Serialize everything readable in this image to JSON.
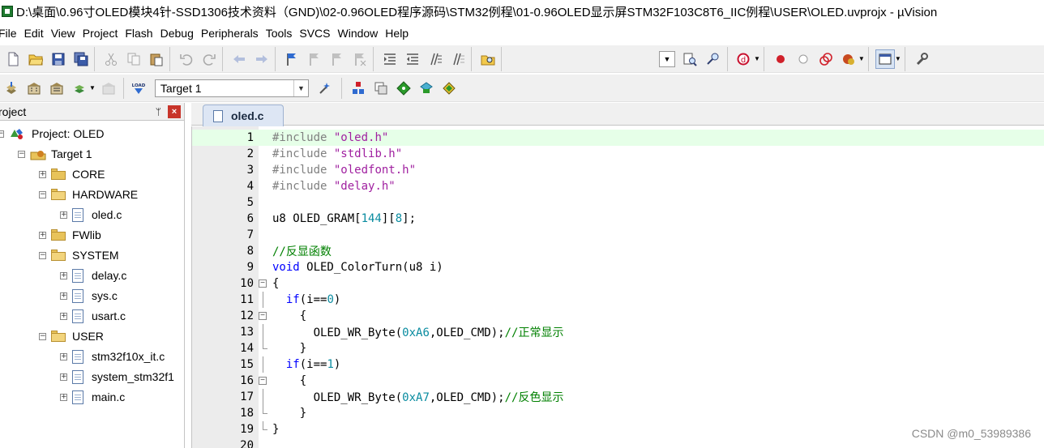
{
  "window": {
    "title": "D:\\桌面\\0.96寸OLED模块4针-SSD1306技术资料（GND)\\02-0.96OLED程序源码\\STM32例程\\01-0.96OLED显示屏STM32F103C8T6_IIC例程\\USER\\OLED.uvprojx - µVision"
  },
  "menu": [
    "File",
    "Edit",
    "View",
    "Project",
    "Flash",
    "Debug",
    "Peripherals",
    "Tools",
    "SVCS",
    "Window",
    "Help"
  ],
  "toolbar2": {
    "target_value": "Target 1",
    "load_label": "LOAD"
  },
  "project_pane": {
    "title": "roject",
    "pin_glyph": "ᛘ",
    "close_glyph": "×",
    "tree": {
      "project": "Project: OLED",
      "target": "Target 1",
      "core": "CORE",
      "hardware": "HARDWARE",
      "oled_c": "oled.c",
      "fwlib": "FWlib",
      "system": "SYSTEM",
      "delay_c": "delay.c",
      "sys_c": "sys.c",
      "usart_c": "usart.c",
      "user": "USER",
      "stm32_it": "stm32f10x_it.c",
      "system_stm32": "system_stm32f1",
      "main_c": "main.c"
    }
  },
  "editor": {
    "tab_label": "oled.c",
    "lines": [
      {
        "n": "1",
        "include": "#include",
        "file": "\"oled.h\""
      },
      {
        "n": "2",
        "include": "#include",
        "file": "\"stdlib.h\""
      },
      {
        "n": "3",
        "include": "#include",
        "file": "\"oledfont.h\""
      },
      {
        "n": "4",
        "include": "#include",
        "file": "\"delay.h\""
      },
      {
        "n": "5"
      },
      {
        "n": "6",
        "decl_a": "u8 OLED_GRAM[",
        "num1": "144",
        "decl_b": "][",
        "num2": "8",
        "decl_c": "];"
      },
      {
        "n": "7"
      },
      {
        "n": "8",
        "comment": "//反显函数"
      },
      {
        "n": "9",
        "kw": "void",
        "rest": " OLED_ColorTurn(u8 i)"
      },
      {
        "n": "10",
        "text": "{"
      },
      {
        "n": "11",
        "kw": "if",
        "rest_a": "(i==",
        "num": "0",
        "rest_b": ")"
      },
      {
        "n": "12",
        "text": "{"
      },
      {
        "n": "13",
        "call": "OLED_WR_Byte(",
        "num": "0xA6",
        "call_b": ",OLED_CMD);",
        "comment": "//正常显示"
      },
      {
        "n": "14",
        "text": "}"
      },
      {
        "n": "15",
        "kw": "if",
        "rest_a": "(i==",
        "num": "1",
        "rest_b": ")"
      },
      {
        "n": "16",
        "text": "{"
      },
      {
        "n": "17",
        "call": "OLED_WR_Byte(",
        "num": "0xA7",
        "call_b": ",OLED_CMD);",
        "comment": "//反色显示"
      },
      {
        "n": "18",
        "text": "}"
      },
      {
        "n": "19",
        "text": "}"
      },
      {
        "n": "20"
      }
    ]
  },
  "watermark": "CSDN @m0_53989386",
  "colors": {
    "current_line": "#e6ffe8",
    "preprocessor": "#808080",
    "string": "#a020a0",
    "number": "#0a8ca0",
    "keyword": "#0000ff",
    "comment": "#008000"
  }
}
